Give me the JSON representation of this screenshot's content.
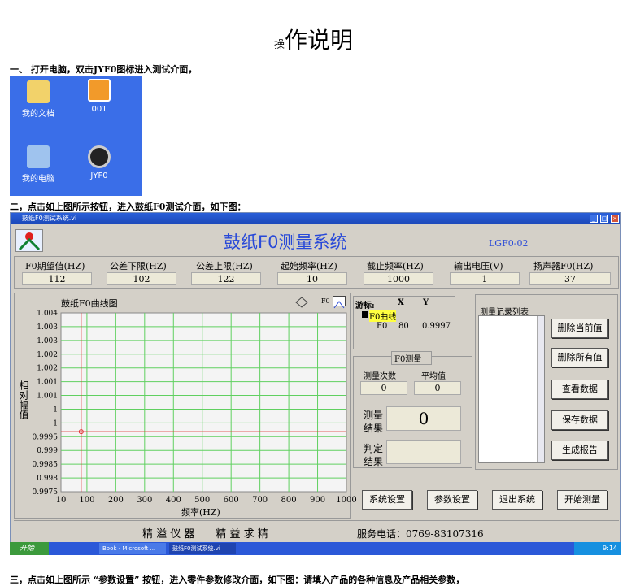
{
  "doc": {
    "title_small": "操",
    "title_main": "作说明",
    "step1": "一、 打开电脑，双击JYF0图标进入测试介面，",
    "step2": "二，点击如上图所示按钮，进入鼓纸F0测试介面，如下图：",
    "step3": "三，点击如上图所示 “参数设置” 按钮，进入零件参数修改介面，如下图：请填入产品的各种信息及产品相关参数，"
  },
  "desktop": {
    "icons": [
      {
        "label": "我的文档",
        "icon": "folder-icon"
      },
      {
        "label": "001",
        "icon": "bmp-file-icon"
      },
      {
        "label": "我的电脑",
        "icon": "computer-icon"
      },
      {
        "label": "JYF0",
        "icon": "speaker-icon"
      }
    ]
  },
  "window": {
    "title": "鼓纸F0测试系统.vi",
    "app_title": "鼓纸F0测量系统",
    "model": "LGF0-02",
    "params": [
      {
        "label": "F0期望值(HZ)",
        "value": "112"
      },
      {
        "label": "公差下限(HZ)",
        "value": "102"
      },
      {
        "label": "公差上限(HZ)",
        "value": "122"
      },
      {
        "label": "起始频率(HZ)",
        "value": "10"
      },
      {
        "label": "截止频率(HZ)",
        "value": "1000"
      },
      {
        "label": "输出电压(V)",
        "value": "1"
      },
      {
        "label": "扬声器F0(HZ)",
        "value": "37"
      }
    ],
    "cursor": {
      "label": "游标:",
      "x_head": "X",
      "y_head": "Y",
      "curve": "F0曲线",
      "name": "F0",
      "x": "80",
      "y": "0.9997"
    },
    "measure": {
      "group": "F0测量",
      "count_label": "测量次数",
      "avg_label": "平均值",
      "count": "0",
      "avg": "0",
      "result_label_1": "测量",
      "result_label_2": "结果",
      "result": "0",
      "judge_label_1": "判定",
      "judge_label_2": "结果"
    },
    "record": {
      "title": "测量记录列表"
    },
    "buttons": {
      "delete_current": "删除当前值",
      "delete_all": "删除所有值",
      "view_data": "查看数据",
      "save_data": "保存数据",
      "report": "生成报告",
      "system_settings": "系统设置",
      "param_settings": "参数设置",
      "exit": "退出系统",
      "start": "开始测量"
    },
    "footer": {
      "company": "精 溢 仪 器　　精 益 求 精",
      "phone": "服务电话：0769-83107316"
    },
    "legend_label": "F0",
    "taskbar": {
      "start": "开始",
      "item1": "Book - Microsoft ...",
      "item2": "鼓纸F0测试系统.vi",
      "time": "9:14"
    }
  },
  "chart_data": {
    "type": "line",
    "title": "鼓纸F0曲线图",
    "xlabel": "频率(HZ)",
    "ylabel": "相对幅值",
    "x_ticks": [
      "10",
      "100",
      "200",
      "300",
      "400",
      "500",
      "600",
      "700",
      "800",
      "900",
      "1000"
    ],
    "y_ticks": [
      "1.004",
      "1.003",
      "1.003",
      "1.002",
      "1.002",
      "1.001",
      "1.001",
      "1",
      "1",
      "0.9995",
      "0.999",
      "0.9985",
      "0.998",
      "0.9975"
    ],
    "xlim": [
      10,
      1000
    ],
    "cursor_x": 80,
    "cursor_y": 0.9997,
    "grid": true
  }
}
